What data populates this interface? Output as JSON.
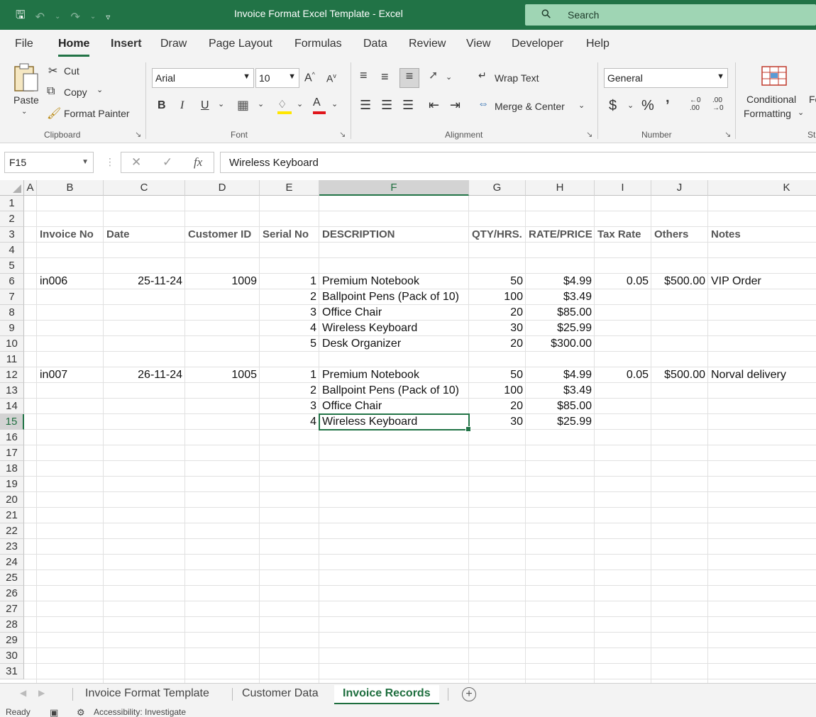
{
  "window": {
    "title": "Invoice Format Excel Template  -  Excel",
    "search_label": "Search"
  },
  "menu": {
    "tabs": [
      "File",
      "Home",
      "Insert",
      "Draw",
      "Page Layout",
      "Formulas",
      "Data",
      "Review",
      "View",
      "Developer",
      "Help"
    ],
    "active": "Home"
  },
  "ribbon": {
    "clipboard": {
      "paste": "Paste",
      "cut": "Cut",
      "copy": "Copy",
      "format_painter": "Format Painter",
      "label": "Clipboard"
    },
    "font": {
      "name": "Arial",
      "size": "10",
      "bold": "B",
      "italic": "I",
      "underline": "U",
      "label": "Font"
    },
    "alignment": {
      "wrap_text": "Wrap Text",
      "merge_center": "Merge & Center",
      "label": "Alignment"
    },
    "number": {
      "format": "General",
      "currency": "$",
      "percent": "%",
      "comma": "މ",
      "inc_decimal": ".00",
      "dec_decimal": ".00",
      "label": "Number"
    },
    "styles": {
      "conditional_1": "Conditional",
      "conditional_2": "Formatting",
      "next_1": "Fo",
      "next_label": "St"
    }
  },
  "formula_bar": {
    "name_box": "F15",
    "fx": "fx",
    "value": "Wireless Keyboard"
  },
  "columns": [
    "A",
    "B",
    "C",
    "D",
    "E",
    "F",
    "G",
    "H",
    "I",
    "J",
    "K"
  ],
  "selected_column": "F",
  "selected_row": "15",
  "rows": [
    "1",
    "2",
    "3",
    "4",
    "5",
    "6",
    "7",
    "8",
    "9",
    "10",
    "11",
    "12",
    "13",
    "14",
    "15",
    "16",
    "17",
    "18",
    "19",
    "20",
    "21",
    "22",
    "23",
    "24",
    "25",
    "26",
    "27",
    "28",
    "29",
    "30",
    "31"
  ],
  "headers": {
    "invoice_no": "Invoice No",
    "date": "Date",
    "customer_id": "Customer ID",
    "serial_no": "Serial No",
    "description": "DESCRIPTION",
    "qty": "QTY/HRS.",
    "rate": "RATE/PRICE",
    "tax_rate": "Tax Rate",
    "others": "Others",
    "notes": "Notes"
  },
  "records": [
    {
      "row": 6,
      "invoice_no": "in006",
      "date": "25-11-24",
      "customer_id": "1009",
      "serial_no": "1",
      "description": "Premium Notebook",
      "qty": "50",
      "rate": "$4.99",
      "tax_rate": "0.05",
      "others": "$500.00",
      "notes": "VIP Order"
    },
    {
      "row": 7,
      "invoice_no": "",
      "date": "",
      "customer_id": "",
      "serial_no": "2",
      "description": "Ballpoint Pens (Pack of 10)",
      "qty": "100",
      "rate": "$3.49",
      "tax_rate": "",
      "others": "",
      "notes": ""
    },
    {
      "row": 8,
      "invoice_no": "",
      "date": "",
      "customer_id": "",
      "serial_no": "3",
      "description": "Office Chair",
      "qty": "20",
      "rate": "$85.00",
      "tax_rate": "",
      "others": "",
      "notes": ""
    },
    {
      "row": 9,
      "invoice_no": "",
      "date": "",
      "customer_id": "",
      "serial_no": "4",
      "description": "Wireless Keyboard",
      "qty": "30",
      "rate": "$25.99",
      "tax_rate": "",
      "others": "",
      "notes": ""
    },
    {
      "row": 10,
      "invoice_no": "",
      "date": "",
      "customer_id": "",
      "serial_no": "5",
      "description": "Desk Organizer",
      "qty": "20",
      "rate": "$300.00",
      "tax_rate": "",
      "others": "",
      "notes": ""
    },
    {
      "row": 12,
      "invoice_no": "in007",
      "date": "26-11-24",
      "customer_id": "1005",
      "serial_no": "1",
      "description": "Premium Notebook",
      "qty": "50",
      "rate": "$4.99",
      "tax_rate": "0.05",
      "others": "$500.00",
      "notes": "Norval delivery"
    },
    {
      "row": 13,
      "invoice_no": "",
      "date": "",
      "customer_id": "",
      "serial_no": "2",
      "description": "Ballpoint Pens (Pack of 10)",
      "qty": "100",
      "rate": "$3.49",
      "tax_rate": "",
      "others": "",
      "notes": ""
    },
    {
      "row": 14,
      "invoice_no": "",
      "date": "",
      "customer_id": "",
      "serial_no": "3",
      "description": "Office Chair",
      "qty": "20",
      "rate": "$85.00",
      "tax_rate": "",
      "others": "",
      "notes": ""
    },
    {
      "row": 15,
      "invoice_no": "",
      "date": "",
      "customer_id": "",
      "serial_no": "4",
      "description": "Wireless Keyboard",
      "qty": "30",
      "rate": "$25.99",
      "tax_rate": "",
      "others": "",
      "notes": ""
    }
  ],
  "sheets": {
    "tabs": [
      "Invoice Format Template",
      "Customer Data",
      "Invoice Records"
    ],
    "active": "Invoice Records"
  },
  "status": {
    "ready": "Ready",
    "accessibility": "Accessibility: Investigate"
  },
  "colors": {
    "accent": "#217346",
    "search_bg": "#9fd5b4"
  }
}
